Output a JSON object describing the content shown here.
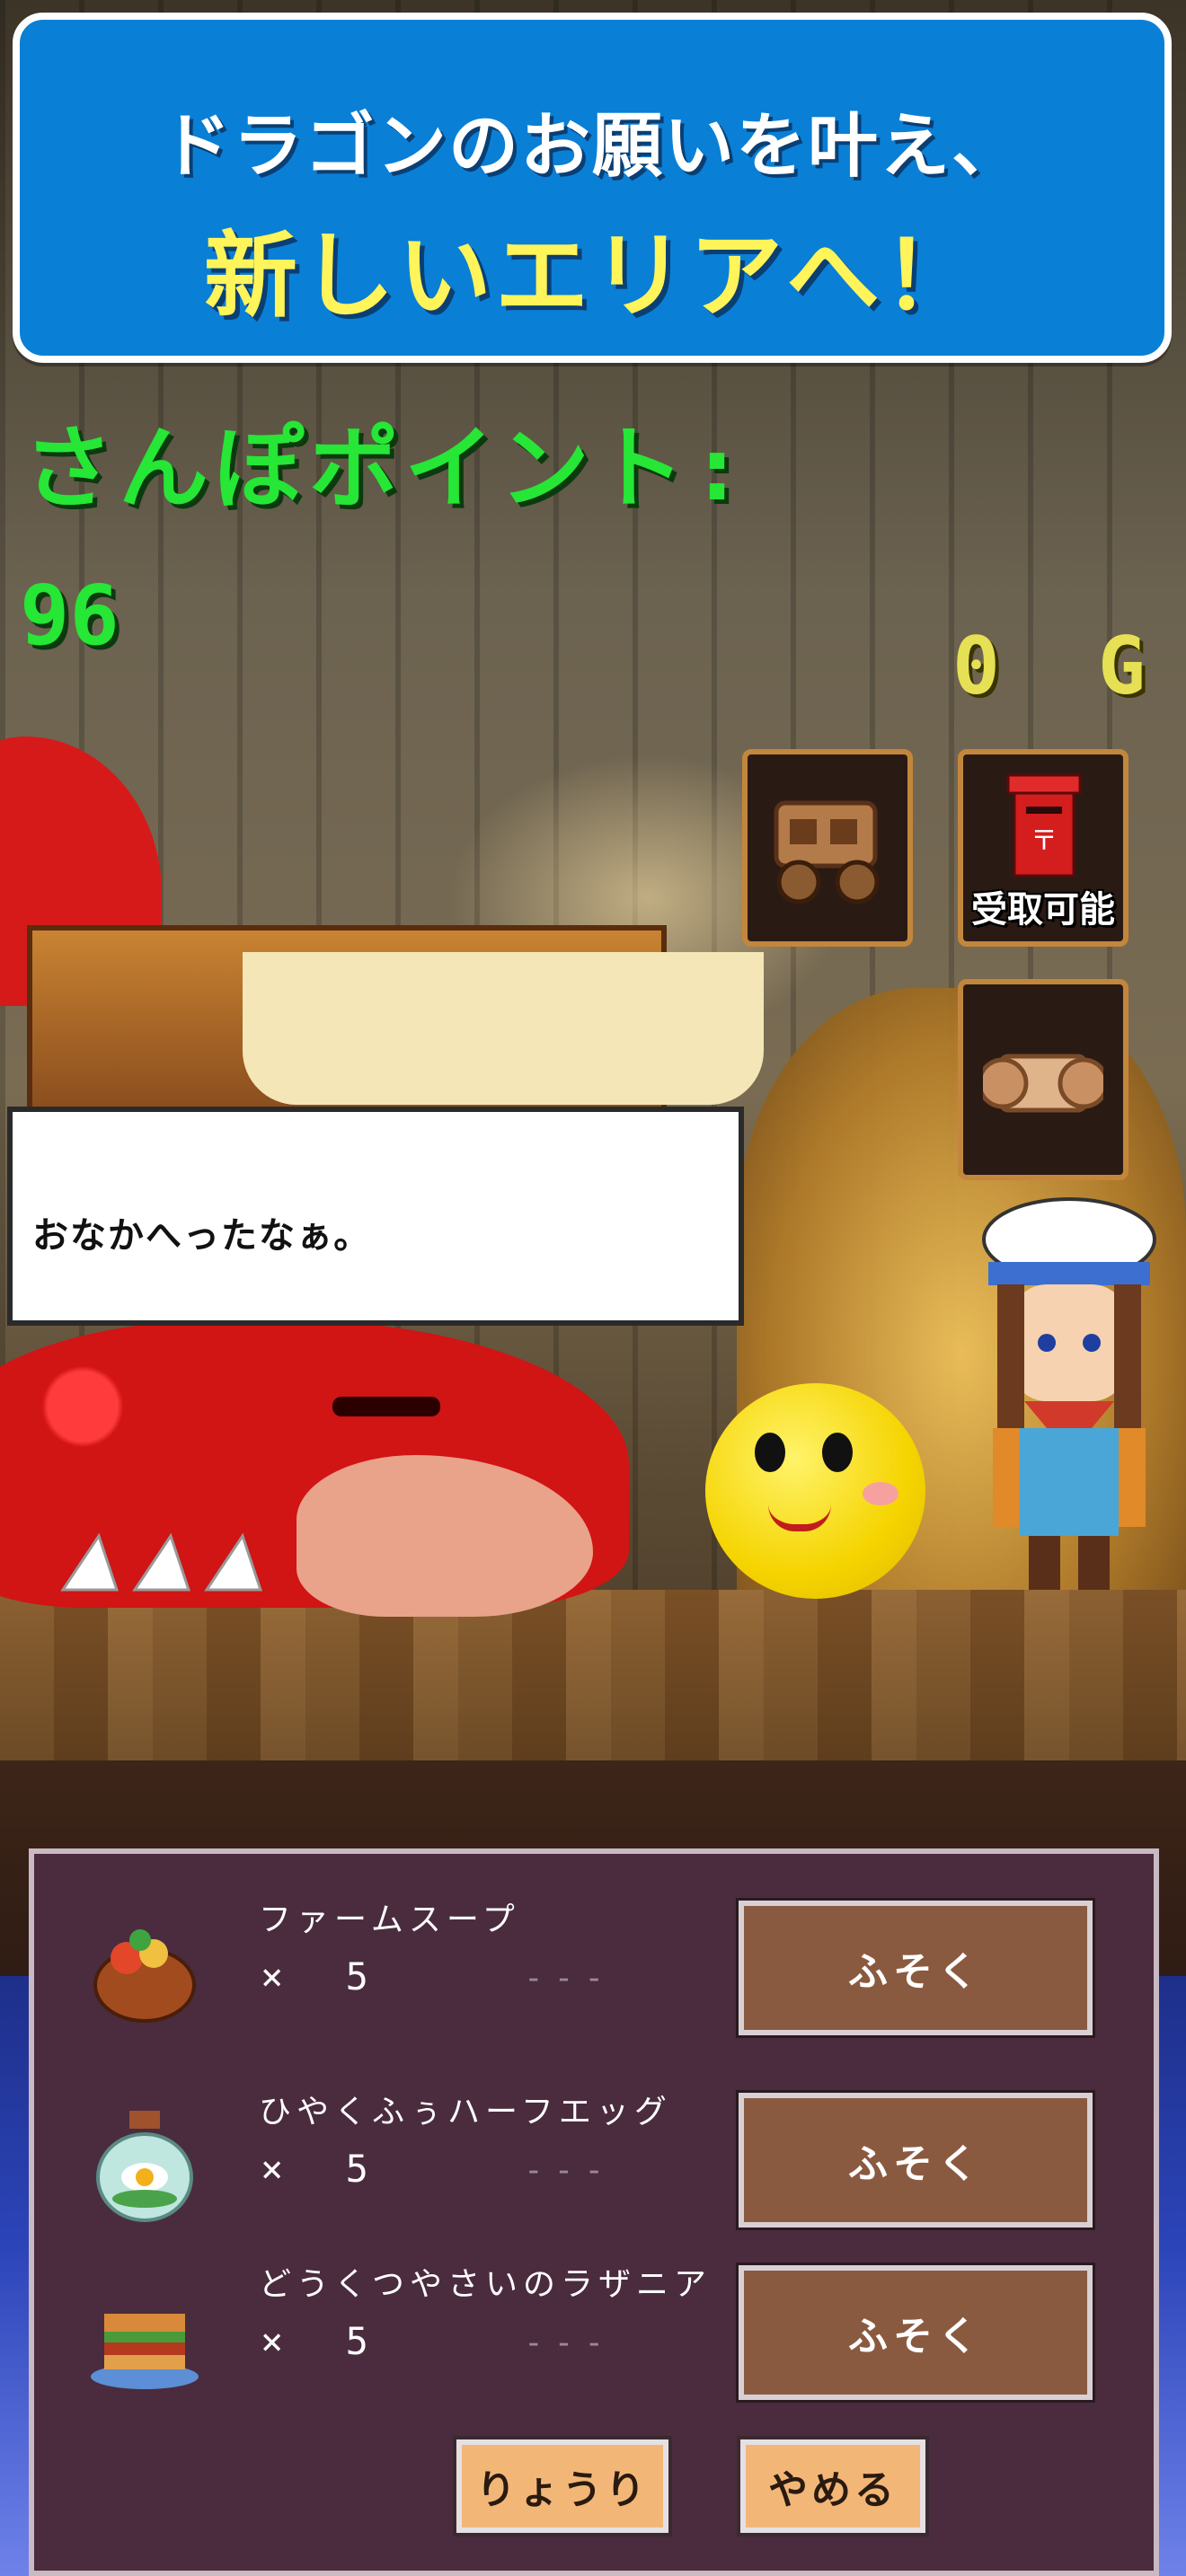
{
  "banner": {
    "line1": "ドラゴンのお願いを叶え、",
    "line2": "新しいエリアへ！"
  },
  "hud": {
    "stroll_label": "さんぽポイント:",
    "stroll_value": "96",
    "gold": "0 G"
  },
  "side_menu": {
    "wagon_icon": "wagon-icon",
    "mailbox_icon": "mailbox-icon",
    "mailbox_label": "受取可能",
    "scroll_icon": "scroll-icon"
  },
  "dialog": {
    "text": "おなかへったなぁ。"
  },
  "recipes": [
    {
      "name": "ファームスープ",
      "qty": "× 5",
      "stock": "---",
      "button": "ふそく",
      "icon": "soup-bowl-icon"
    },
    {
      "name": "ひやくふぅハーフエッグ",
      "qty": "× 5",
      "stock": "---",
      "button": "ふそく",
      "icon": "bottle-egg-icon"
    },
    {
      "name": "どうくつやさいのラザニア",
      "qty": "× 5",
      "stock": "---",
      "button": "ふそく",
      "icon": "lasagna-icon"
    }
  ],
  "actions": {
    "cook": "りょうり",
    "cancel": "やめる"
  },
  "colors": {
    "banner_bg": "#0a7fd6",
    "banner_highlight": "#fff45a",
    "hud_green": "#26e636",
    "gold_text": "#e6e054",
    "panel_bg": "#4a2c3e",
    "lack_button": "#8a5a40",
    "action_button": "#f2b777"
  }
}
